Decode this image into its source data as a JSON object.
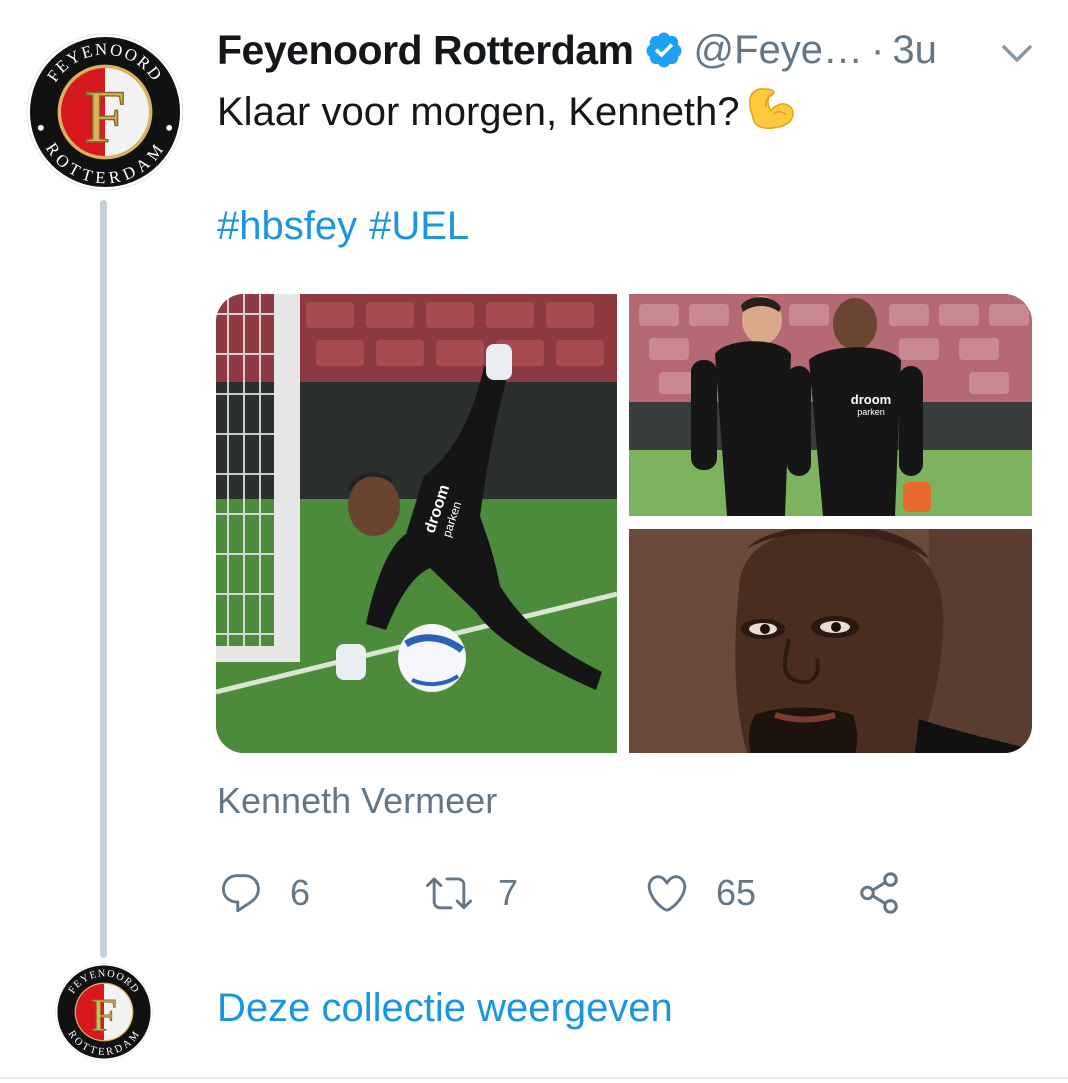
{
  "tweet": {
    "display_name": "Feyenoord Rotterdam",
    "handle": "@Feye…",
    "separator": "·",
    "time": "3u",
    "text": "Klaar voor morgen, Kenneth?",
    "emoji": "flexed-biceps-emoji",
    "hashtags": [
      "#hbsfey",
      "#UEL"
    ],
    "media_caption": "Kenneth Vermeer",
    "actions": {
      "reply_count": "6",
      "retweet_count": "7",
      "like_count": "65"
    }
  },
  "thread": {
    "show_collection_label": "Deze collectie weergeven"
  },
  "badge": {
    "top_text": "FEYENOORD",
    "bottom_text": "ROTTERDAM",
    "letter": "F"
  },
  "photos": {
    "main_print_top": "droom",
    "main_print_bottom": "parken",
    "side_print_top": "droom",
    "side_print_bottom": "parken"
  },
  "icons": {
    "verified": "verified-badge-icon",
    "caret": "chevron-down-icon",
    "reply": "reply-icon",
    "retweet": "retweet-icon",
    "like": "heart-icon",
    "share": "share-icon"
  },
  "colors": {
    "link": "#1b95e0",
    "muted": "#657786",
    "text": "#14171a",
    "thread_line": "#c4cfd6",
    "badge_red": "#d7191f",
    "badge_gold": "#d9b15f"
  }
}
